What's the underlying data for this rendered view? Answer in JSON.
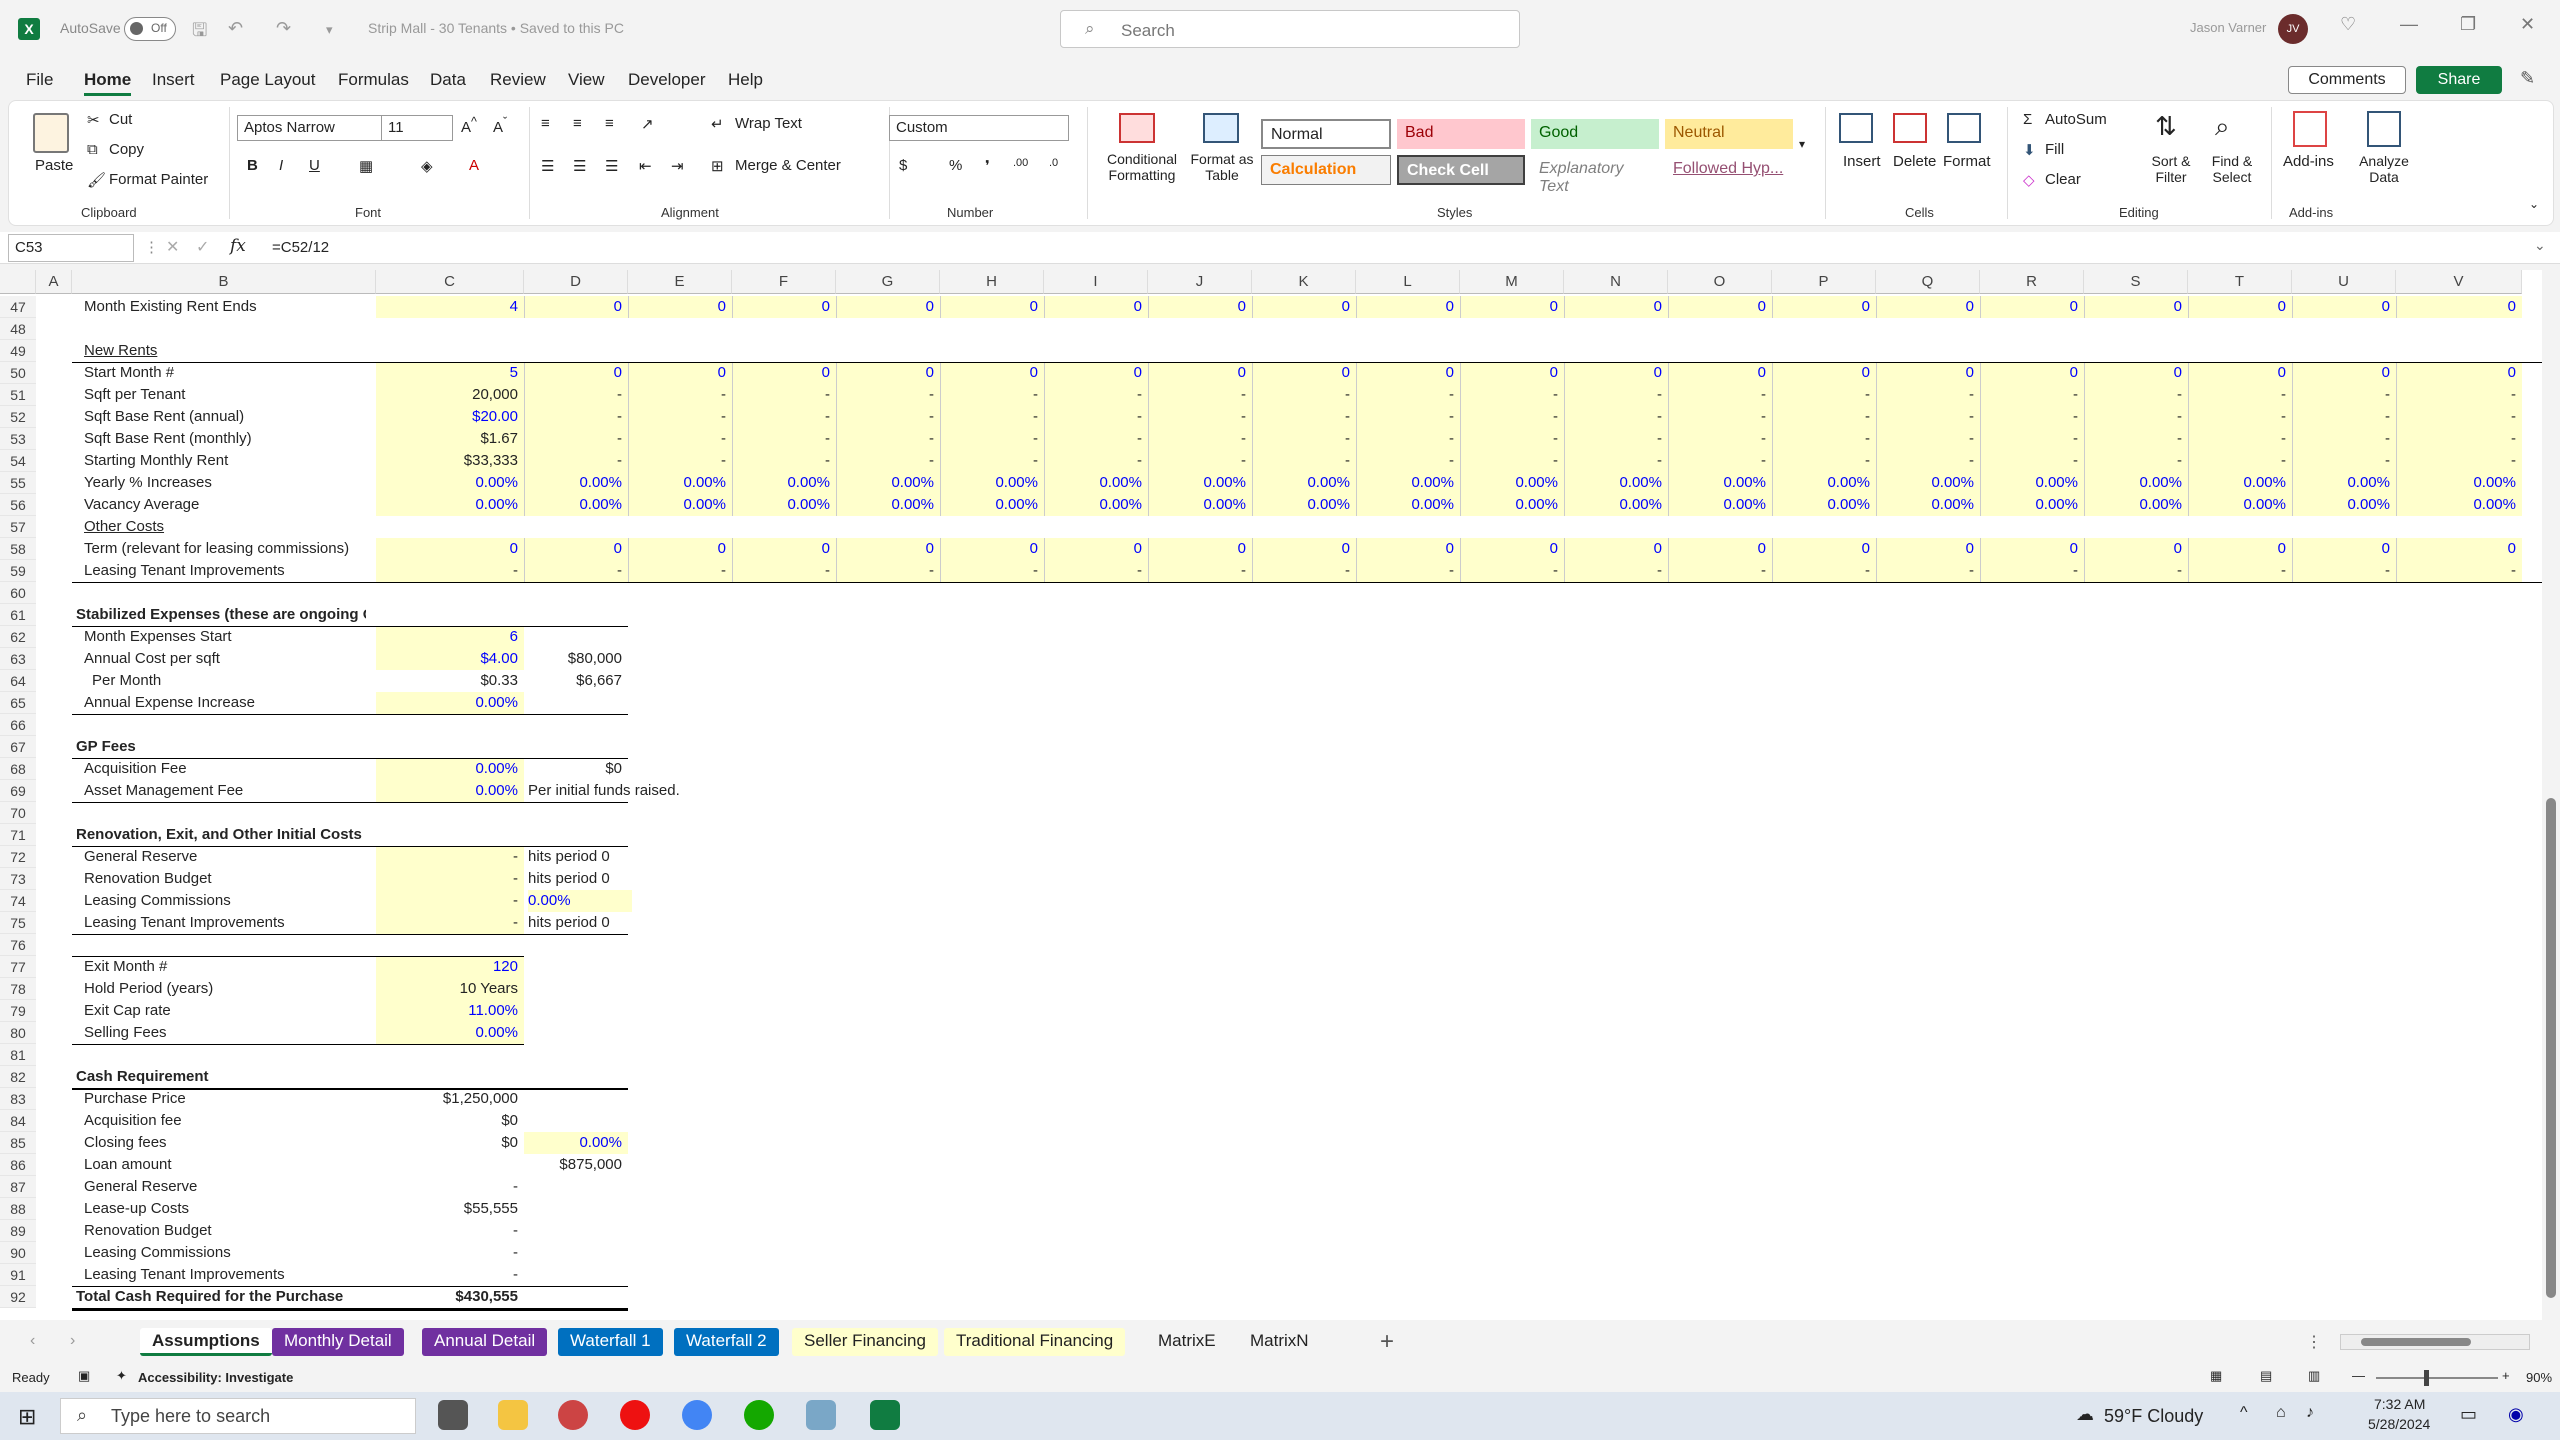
{
  "titlebar": {
    "autosave": "AutoSave",
    "toggle": "Off",
    "title": "Strip Mall - 30 Tenants  •  Saved to this PC",
    "search": "Search",
    "user": "Jason Varner",
    "initials": "JV"
  },
  "menu": {
    "file": "File",
    "home": "Home",
    "insert": "Insert",
    "page_layout": "Page Layout",
    "formulas": "Formulas",
    "data": "Data",
    "review": "Review",
    "view": "View",
    "developer": "Developer",
    "help": "Help",
    "comments": "Comments",
    "share": "Share"
  },
  "ribbon": {
    "paste": "Paste",
    "cut": "Cut",
    "copy": "Copy",
    "format_painter": "Format Painter",
    "clipboard": "Clipboard",
    "font_name": "Aptos Narrow",
    "font_size": "11",
    "font": "Font",
    "wrap_text": "Wrap Text",
    "merge_center": "Merge & Center",
    "alignment": "Alignment",
    "number_format": "Custom",
    "number": "Number",
    "conditional": "Conditional Formatting",
    "format_table": "Format as Table",
    "styles": "Styles",
    "normal": "Normal",
    "bad": "Bad",
    "good": "Good",
    "neutral": "Neutral",
    "calculation": "Calculation",
    "check_cell": "Check Cell",
    "explanatory": "Explanatory Text",
    "followed": "Followed Hyp...",
    "insert": "Insert",
    "delete": "Delete",
    "format": "Format",
    "cells": "Cells",
    "autosum": "AutoSum",
    "fill": "Fill",
    "clear": "Clear",
    "sort_filter": "Sort & Filter",
    "find_select": "Find & Select",
    "editing": "Editing",
    "addins": "Add-ins",
    "addins_grp": "Add-ins",
    "analyze": "Analyze Data",
    "bold": "B",
    "italic": "I",
    "underline": "U"
  },
  "formula_bar": {
    "name_box": "C53",
    "formula": "=C52/12"
  },
  "columns": [
    "A",
    "B",
    "C",
    "D",
    "E",
    "F",
    "G",
    "H",
    "I",
    "J",
    "K",
    "L",
    "M",
    "N",
    "O",
    "P",
    "Q",
    "R",
    "S",
    "T",
    "U",
    "V"
  ],
  "rows": [
    "47",
    "48",
    "49",
    "50",
    "51",
    "52",
    "53",
    "54",
    "55",
    "56",
    "57",
    "58",
    "59",
    "60",
    "61",
    "62",
    "63",
    "64",
    "65",
    "66",
    "67",
    "68",
    "69",
    "70",
    "71",
    "72",
    "73",
    "74",
    "75",
    "76",
    "77",
    "78",
    "79",
    "80",
    "81",
    "82",
    "83",
    "84",
    "85",
    "86",
    "87",
    "88",
    "89",
    "90",
    "91",
    "92"
  ],
  "labels": {
    "r47": "Month Existing Rent Ends",
    "r49": "New Rents",
    "r50": "Start Month #",
    "r51": "Sqft per Tenant",
    "r52": "Sqft Base Rent (annual)",
    "r53": "Sqft Base Rent (monthly)",
    "r54": "Starting Monthly Rent",
    "r55": "Yearly % Increases",
    "r56": "Vacancy Average",
    "r57": "Other Costs",
    "r58": "Term (relevant for leasing commissions)",
    "r59": "Leasing Tenant Improvements",
    "r61": "Stabilized Expenses (these are ongoing OPEXs for landlord)",
    "r62": "Month Expenses Start",
    "r63": "Annual Cost per sqft",
    "r64": "Per Month",
    "r65": "Annual Expense Increase",
    "r67": "GP Fees",
    "r68": "Acquisition Fee",
    "r69": "Asset Management Fee",
    "r71": "Renovation, Exit, and Other Initial Costs",
    "r72": "General Reserve",
    "r73": "Renovation Budget",
    "r74": "Leasing Commissions",
    "r75": "Leasing Tenant Improvements",
    "r77": "Exit Month #",
    "r78": "Hold Period (years)",
    "r79": "Exit Cap rate",
    "r80": "Selling Fees",
    "r82": "Cash Requirement",
    "r83": "Purchase Price",
    "r84": "Acquisition fee",
    "r85": "Closing fees",
    "r86": "Loan amount",
    "r87": "General Reserve",
    "r88": "Lease-up Costs",
    "r89": "Renovation Budget",
    "r90": "Leasing Commissions",
    "r91": "Leasing Tenant Improvements",
    "r92": "Total Cash Required for the Purchase"
  },
  "cvals": {
    "r47": "4",
    "r50": "5",
    "r51": "20,000",
    "r52": "$20.00",
    "r53": "$1.67",
    "r54": "$33,333",
    "r55": "0.00%",
    "r56": "0.00%",
    "r58": "0",
    "r59": "-",
    "r62": "6",
    "r63": "$4.00",
    "r64": "$0.33",
    "r65": "0.00%",
    "r68": "0.00%",
    "r69": "0.00%",
    "r72": "-",
    "r73": "-",
    "r74": "-",
    "r75": "-",
    "r77": "120",
    "r78": "10 Years",
    "r79": "11.00%",
    "r80": "0.00%",
    "r83": "$1,250,000",
    "r84": "$0",
    "r85": "$0",
    "r86": "",
    "r87": "-",
    "r88": "$55,555",
    "r89": "-",
    "r90": "-",
    "r91": "-",
    "r92": "$430,555"
  },
  "dvals": {
    "r63": "$80,000",
    "r64": "$6,667",
    "r68": "$0",
    "r69": "Per initial funds raised.",
    "r72": "hits period 0",
    "r73": "hits period 0",
    "r74": "0.00%",
    "r75": "hits period 0",
    "r85": "0.00%",
    "r86": "$875,000"
  },
  "repeat": {
    "zero": "0",
    "dash": "-",
    "pct": "0.00%",
    "pct_cut": "0.00%"
  },
  "sheets": [
    "Assumptions",
    "Monthly Detail",
    "Annual Detail",
    "Waterfall 1",
    "Waterfall 2",
    "Seller Financing",
    "Traditional Financing",
    "MatrixE",
    "MatrixN"
  ],
  "sheet_colors": [
    "#ffffff",
    "#7030a0",
    "#7030a0",
    "#0070c0",
    "#0070c0",
    "#ffffcc",
    "#ffffcc",
    "#f3f3f3",
    "#f3f3f3"
  ],
  "status": {
    "ready": "Ready",
    "accessibility": "Accessibility: Investigate",
    "zoom": "90%"
  },
  "taskbar": {
    "search": "Type here to search",
    "weather": "59°F  Cloudy",
    "time": "7:32 AM",
    "date": "5/28/2024"
  }
}
